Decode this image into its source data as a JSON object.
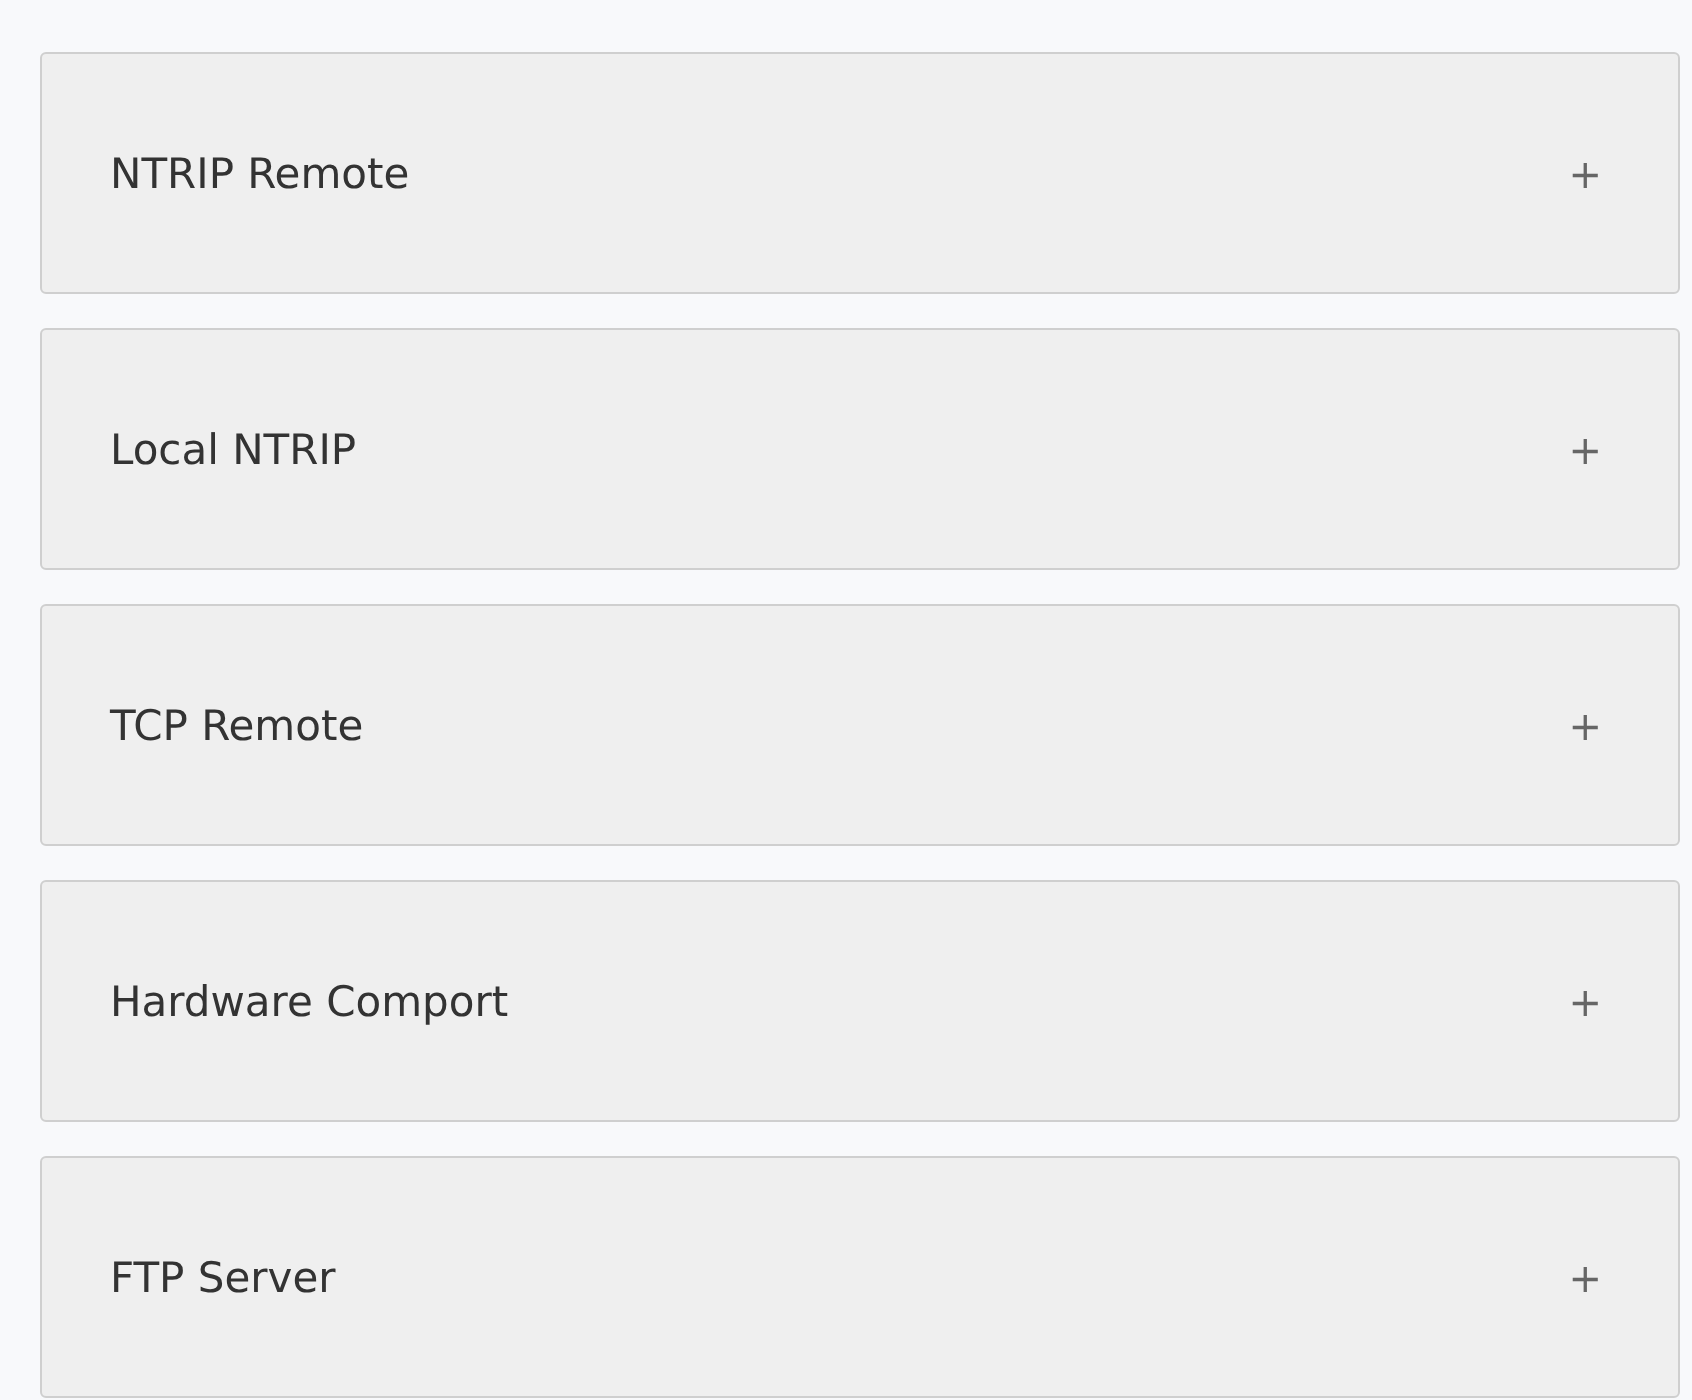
{
  "panels": [
    {
      "title": "NTRIP Remote",
      "toggle": "+",
      "expanded": false
    },
    {
      "title": "Local NTRIP",
      "toggle": "+",
      "expanded": false
    },
    {
      "title": "TCP Remote",
      "toggle": "+",
      "expanded": false
    },
    {
      "title": "Hardware Comport",
      "toggle": "+",
      "expanded": false
    },
    {
      "title": "FTP Server",
      "toggle": "+",
      "expanded": false
    }
  ]
}
